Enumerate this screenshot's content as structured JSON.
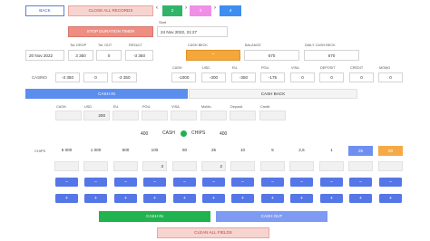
{
  "toolbar": {
    "back": "BACK",
    "close_all": "CLOSE ALL RECORDS",
    "nav_left": "‹",
    "nav_right": "›",
    "tab1": "2",
    "tab2": "3",
    "tab3": "4",
    "timer": "STOP DURATION TIMER",
    "start_label": "Start",
    "start_value": "24 Nov 2022, 21:27"
  },
  "summary": {
    "date": "20 Nov 2022",
    "tot_drop_label": "Tot. DROP",
    "tot_drop": "3 350",
    "tot_out_label": "Tot. OUT",
    "tot_out": "0",
    "result_label": "RESULT",
    "result": "-3 350",
    "casino_label": "CASINO",
    "casino_drop": "-3 350",
    "casino_out": "0",
    "casino_result": "-3 350"
  },
  "cash_right": {
    "cash_beck_label": "CASH BECK",
    "balance_label": "BALANCE",
    "balance": "670",
    "daily_label": "DAILY CASH BECK",
    "daily": "670",
    "cols": [
      {
        "label": "CASH",
        "value": "-1000"
      },
      {
        "label": "USD.",
        "value": "-300"
      },
      {
        "label": "EU.",
        "value": "-350"
      },
      {
        "label": "POU.",
        "value": "-175"
      },
      {
        "label": "VISA",
        "value": "0"
      },
      {
        "label": "DEPOSIT",
        "value": "0"
      },
      {
        "label": "CREDIT",
        "value": "0"
      },
      {
        "label": "MOMO",
        "value": "0"
      }
    ]
  },
  "tabs": {
    "cash_in": "CASH IN",
    "cash_back": "CASH BACK"
  },
  "currency_row": {
    "labels": [
      "CASH.",
      "USD.",
      "EU.",
      "POU.",
      "VISA.",
      "MoMo.",
      "Deposit.",
      "Credit."
    ],
    "values": [
      "",
      "200",
      "",
      "",
      "",
      "",
      "",
      ""
    ]
  },
  "exchange": {
    "cash_total": "400",
    "cash_label": "CASH",
    "chips_label": "CHIPS",
    "chips_total": "400"
  },
  "chips": {
    "label": "CHIPS",
    "denoms": [
      "5 000",
      "1 000",
      "500",
      "100",
      "50",
      "25",
      "10",
      "5",
      "2,5",
      "1",
      "25",
      "50"
    ],
    "counts": [
      "",
      "",
      "",
      "3",
      "",
      "2",
      "",
      "",
      "",
      "",
      "",
      ""
    ],
    "minus": "–",
    "plus": "+"
  },
  "actions": {
    "cash_in": "CASH IN",
    "cash_out": "CASH OUT",
    "clean": "CLEAN ALL FIELDS"
  }
}
